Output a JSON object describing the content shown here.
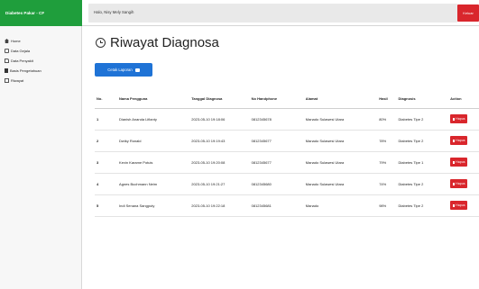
{
  "header": {
    "brand": "Diabetes Pakar - CF",
    "nav_text": "Halo, Nisy Mely Sangih",
    "logout_label": "Keluar"
  },
  "sidebar": {
    "items": [
      {
        "label": "Home",
        "icon": "home-icon"
      },
      {
        "label": "Data Gejala",
        "icon": "list-icon"
      },
      {
        "label": "Data Penyakit",
        "icon": "file-icon"
      },
      {
        "label": "Basis Pengetahuan",
        "icon": "bar-icon"
      },
      {
        "label": "Riwayat",
        "icon": "document-icon"
      }
    ]
  },
  "page": {
    "title": "Riwayat Diagnosa",
    "print_button": "Cetak Laporan"
  },
  "table": {
    "columns": [
      "No.",
      "Nama Pengguna",
      "Tanggal Diagnosa",
      "No Handphone",
      "Alamat",
      "Hasil",
      "Diagnosis",
      "Action"
    ],
    "rows": [
      {
        "no": "1",
        "nama": "Dianish Ananda Lifianty",
        "tanggal": "2023-05-10 19:18:06",
        "hp": "0812345678",
        "alamat": "Manado Sulawesi Utara",
        "hasil": "80%",
        "diagnosis": "Diabetes Tipe 2",
        "action": "Hapus"
      },
      {
        "no": "2",
        "nama": "Dwiky Ronald",
        "tanggal": "2023-05-10 19:19:43",
        "hp": "0812345677",
        "alamat": "Manado Sulawesi Utara",
        "hasil": "78%",
        "diagnosis": "Diabetes Tipe 2",
        "action": "Hapus"
      },
      {
        "no": "3",
        "nama": "Kevin Karame Potuis",
        "tanggal": "2023-05-10 19:20:08",
        "hp": "0812345677",
        "alamat": "Manado Sulawesi Utara",
        "hasil": "79%",
        "diagnosis": "Diabetes Tipe 1",
        "action": "Hapus"
      },
      {
        "no": "4",
        "nama": "Agnes Buchmann Neim",
        "tanggal": "2023-05-10 19:21:27",
        "hp": "0812345680",
        "alamat": "Manado Sulawesi Utara",
        "hasil": "74%",
        "diagnosis": "Diabetes Tipe 2",
        "action": "Hapus"
      },
      {
        "no": "5",
        "nama": "Indi Senana Sangputy",
        "tanggal": "2023-05-10 19:22:18",
        "hp": "0812345681",
        "alamat": "Manado",
        "hasil": "98%",
        "diagnosis": "Diabetes Tipe 2",
        "action": "Hapus"
      }
    ]
  },
  "colors": {
    "brand_green": "#1f9e3c",
    "primary_blue": "#1f73d6",
    "danger_red": "#d9262c"
  }
}
